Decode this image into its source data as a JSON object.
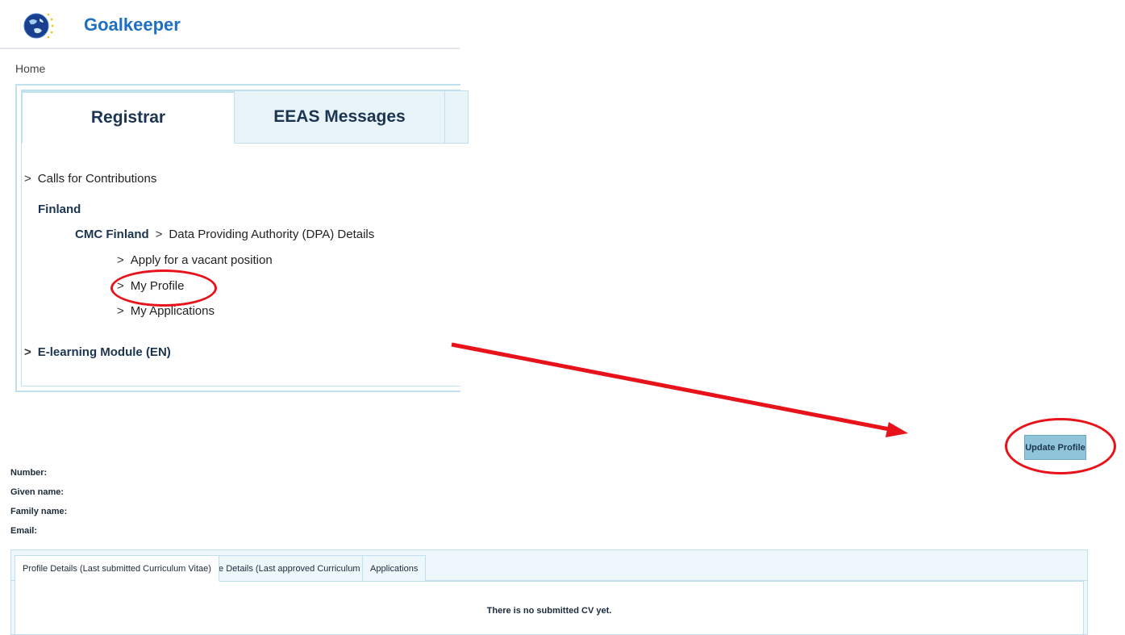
{
  "header": {
    "title": "Goalkeeper",
    "logo_icon": "globe-stars-logo"
  },
  "breadcrumb": "Home",
  "tabs": [
    {
      "label": "Registrar",
      "active": true
    },
    {
      "label": "EEAS Messages",
      "active": false
    }
  ],
  "nav": {
    "calls": "Calls for Contributions",
    "country": "Finland",
    "org": "CMC Finland",
    "dpa": "Data Providing Authority (DPA) Details",
    "apply": "Apply for a vacant position",
    "profile": "My Profile",
    "applications": "My Applications",
    "elearning": "E-learning Module (EN)"
  },
  "chevron": ">",
  "update_button": "Update Profile",
  "fields": {
    "number": "Number:",
    "given_name": "Given name:",
    "family_name": "Family name:",
    "email": "Email:"
  },
  "bottom_tabs": [
    {
      "label": "Profile Details (Last submitted Curriculum Vitae)",
      "active": true
    },
    {
      "label": "Profile Details (Last approved Curriculum Vitae)",
      "active": false
    },
    {
      "label": "Applications",
      "active": false
    }
  ],
  "no_cv_message": "There is no submitted CV yet.",
  "colors": {
    "accent": "#1f6fc2",
    "annotation": "#e8131a",
    "tab_border": "#bfe0ee",
    "button": "#8fc4d9"
  }
}
